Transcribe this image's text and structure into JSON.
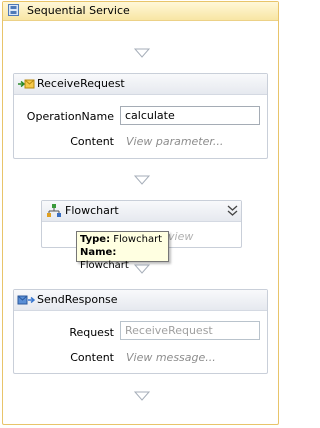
{
  "sequence": {
    "title": "Sequential Service"
  },
  "receive": {
    "title": "ReceiveRequest",
    "operation_label": "OperationName",
    "operation_value": "calculate",
    "content_label": "Content",
    "content_hint": "View parameter..."
  },
  "flowchart": {
    "title": "Flowchart",
    "hidden_text": "view"
  },
  "tooltip": {
    "type_label": "Type:",
    "type_value": "Flowchart",
    "name_label": "Name:",
    "name_value": "Flowchart"
  },
  "send": {
    "title": "SendResponse",
    "request_label": "Request",
    "request_value": "ReceiveRequest",
    "content_label": "Content",
    "content_hint": "View message..."
  },
  "colors": {
    "frame_border": "#e8c46a",
    "frame_header": "#f8e6a4",
    "card_border": "#c9cfd9",
    "tooltip_bg": "#ffffe1"
  }
}
